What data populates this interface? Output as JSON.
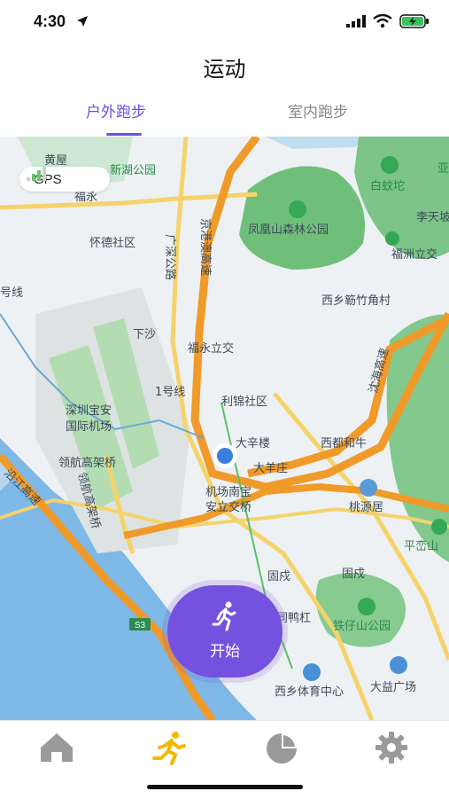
{
  "status_bar": {
    "time": "4:30"
  },
  "header": {
    "title": "运动"
  },
  "tabs": [
    {
      "label": "户外跑步",
      "active": true
    },
    {
      "label": "室内跑步",
      "active": false
    }
  ],
  "map": {
    "gps_label": "GPS",
    "labels": {
      "huangwu": "黄屋",
      "xinhu_park": "新湖公园",
      "fuyong_short": "福永",
      "baiwentuo": "白蚊坨",
      "ya": "亚",
      "jingganghao": "京港澳高速",
      "fenghuangshan": "凤凰山森林公园",
      "litiandu": "李天坡",
      "fuzhou_interchange": "福洲立交",
      "huaide": "怀德社区",
      "guangshen": "广深公路",
      "xixiang_jiaozhu": "西乡簕竹角村",
      "hao_xian": "号线",
      "xiasha": "下沙",
      "fuyong_interchange": "福永立交",
      "shenhai": "沈海高速",
      "line1": "1号线",
      "lijin": "利锦社区",
      "shenzhen_airport_1": "深圳宝安",
      "shenzhen_airport_2": "国际机场",
      "daxinlou": "大辛楼",
      "xiduhe": "西都和牛",
      "linghang1": "领航高架桥",
      "linghang2": "领航高架桥",
      "dayangzhuang": "大羊庄",
      "yanjiang": "沿江高速",
      "airport_south_1": "机场南宝",
      "airport_south_2": "安立交桥",
      "taoyuanju": "桃源居",
      "pingluanshan": "平峦山",
      "gushu1": "固戍",
      "gushu2": "固戍",
      "s3": "S3",
      "tieshan_park": "铁仔山公园",
      "xiayagang": "同鸭杠",
      "xixiang_sports": "西乡体育中心",
      "dayi_plaza": "大益广场"
    }
  },
  "start_button": {
    "label": "开始"
  },
  "tab_bar": {
    "items": [
      {
        "icon": "home-icon",
        "active": false
      },
      {
        "icon": "running-icon",
        "active": true
      },
      {
        "icon": "pie-chart-icon",
        "active": false
      },
      {
        "icon": "gear-icon",
        "active": false
      }
    ]
  },
  "colors": {
    "accent": "#6c4ee6",
    "active_tab_icon": "#f5b800",
    "inactive_tab_icon": "#9a9a9a"
  }
}
